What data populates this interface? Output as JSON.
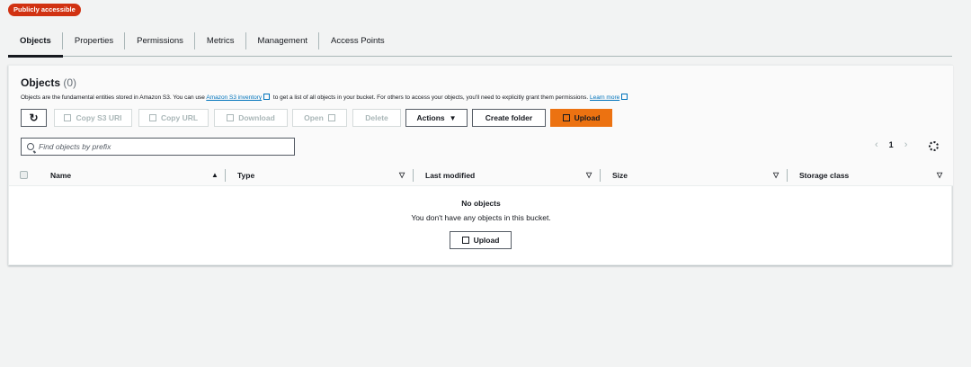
{
  "badge": "Publicly accessible",
  "tabs": [
    {
      "label": "Objects",
      "active": true
    },
    {
      "label": "Properties"
    },
    {
      "label": "Permissions"
    },
    {
      "label": "Metrics"
    },
    {
      "label": "Management"
    },
    {
      "label": "Access Points"
    }
  ],
  "objects": {
    "title": "Objects",
    "count": "(0)",
    "desc_1": "Objects are the fundamental entities stored in Amazon S3. You can use ",
    "desc_link": "Amazon S3 inventory",
    "desc_2": " to get a list of all objects in your bucket. For others to access your objects, you'll need to explicitly grant them permissions. ",
    "learn_more": "Learn more"
  },
  "toolbar": {
    "copy_s3_uri": "Copy S3 URI",
    "copy_url": "Copy URL",
    "download": "Download",
    "open": "Open",
    "delete": "Delete",
    "actions": "Actions",
    "create_folder": "Create folder",
    "upload": "Upload"
  },
  "search": {
    "placeholder": "Find objects by prefix"
  },
  "pager": {
    "page": "1"
  },
  "columns": [
    "Name",
    "Type",
    "Last modified",
    "Size",
    "Storage class"
  ],
  "empty": {
    "title": "No objects",
    "message": "You don't have any objects in this bucket.",
    "upload": "Upload"
  },
  "colors": {
    "accent": "#ec7211",
    "badge": "#d13212",
    "link": "#0073bb"
  }
}
